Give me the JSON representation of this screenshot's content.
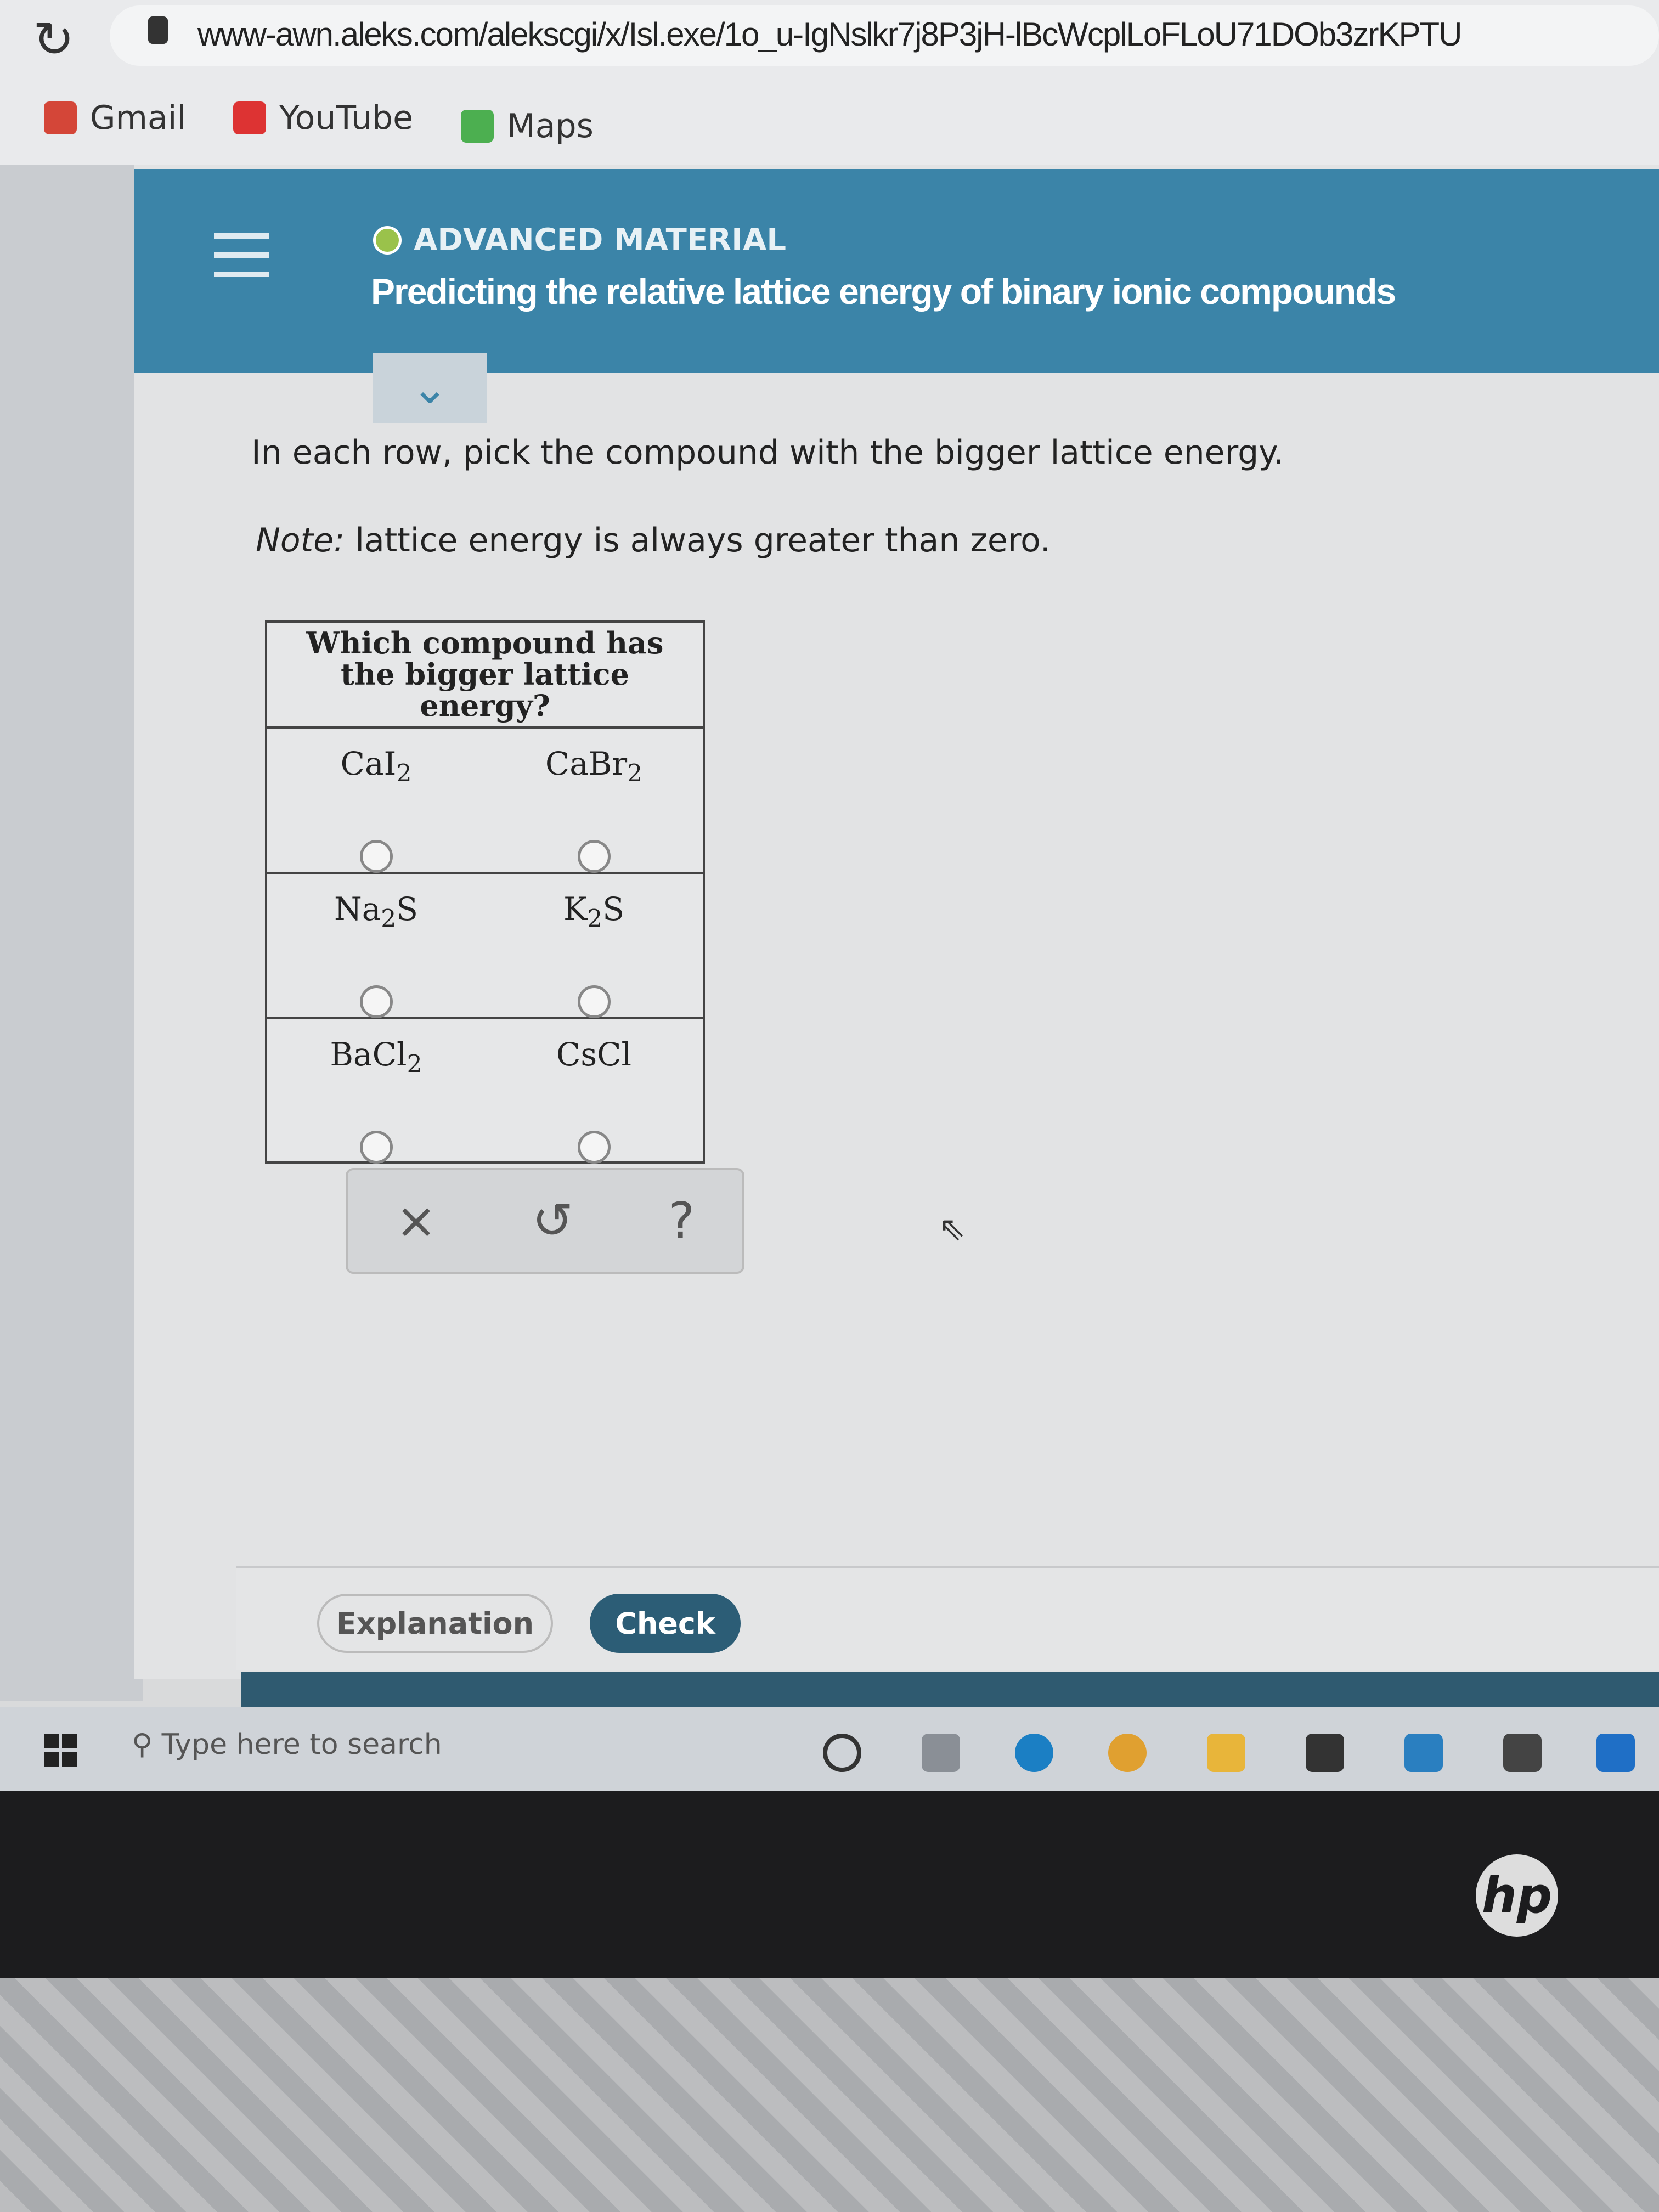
{
  "browser": {
    "url": "www-awn.aleks.com/alekscgi/x/Isl.exe/1o_u-IgNslkr7j8P3jH-lBcWcplLoFLoU71DOb3zrKPTU",
    "bookmarks": [
      {
        "label": "Gmail",
        "icon": "gmail-icon"
      },
      {
        "label": "YouTube",
        "icon": "youtube-icon"
      },
      {
        "label": "Maps",
        "icon": "maps-icon"
      }
    ]
  },
  "header": {
    "category": "ADVANCED MATERIAL",
    "title": "Predicting the relative lattice energy of binary ionic compounds",
    "accent": "#3b84a8"
  },
  "question": {
    "instruction": "In each row, pick the compound with the bigger lattice energy.",
    "note_label": "Note:",
    "note_text": " lattice energy is always greater than zero.",
    "table_header": "Which compound has the bigger lattice energy?",
    "rows": [
      {
        "a": {
          "base": "CaI",
          "sub": "2"
        },
        "b": {
          "base": "CaBr",
          "sub": "2"
        }
      },
      {
        "a": {
          "base": "Na",
          "sub": "2",
          "tail": "S"
        },
        "b": {
          "base": "K",
          "sub": "2",
          "tail": "S"
        }
      },
      {
        "a": {
          "base": "BaCl",
          "sub": "2"
        },
        "b": {
          "base": "CsCl",
          "sub": ""
        }
      }
    ]
  },
  "tools": {
    "clear": "×",
    "undo": "↺",
    "help": "?"
  },
  "footer": {
    "explanation": "Explanation",
    "check": "Check"
  },
  "taskbar": {
    "search_placeholder": "Type here to search"
  },
  "laptop": {
    "logo": "hp"
  }
}
